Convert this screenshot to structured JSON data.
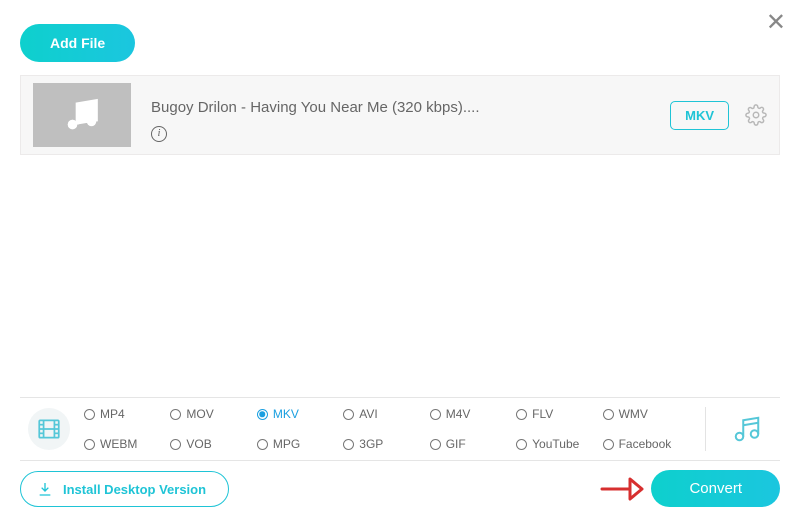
{
  "header": {
    "add_file_label": "Add File"
  },
  "file": {
    "title": "Bugoy Drilon - Having You Near Me (320 kbps)....",
    "format_badge": "MKV"
  },
  "formats": [
    {
      "label": "MP4",
      "selected": false
    },
    {
      "label": "MOV",
      "selected": false
    },
    {
      "label": "MKV",
      "selected": true
    },
    {
      "label": "AVI",
      "selected": false
    },
    {
      "label": "M4V",
      "selected": false
    },
    {
      "label": "FLV",
      "selected": false
    },
    {
      "label": "WMV",
      "selected": false
    },
    {
      "label": "WEBM",
      "selected": false
    },
    {
      "label": "VOB",
      "selected": false
    },
    {
      "label": "MPG",
      "selected": false
    },
    {
      "label": "3GP",
      "selected": false
    },
    {
      "label": "GIF",
      "selected": false
    },
    {
      "label": "YouTube",
      "selected": false
    },
    {
      "label": "Facebook",
      "selected": false
    }
  ],
  "footer": {
    "install_label": "Install Desktop Version",
    "convert_label": "Convert"
  },
  "colors": {
    "accent": "#1fc4d6"
  }
}
